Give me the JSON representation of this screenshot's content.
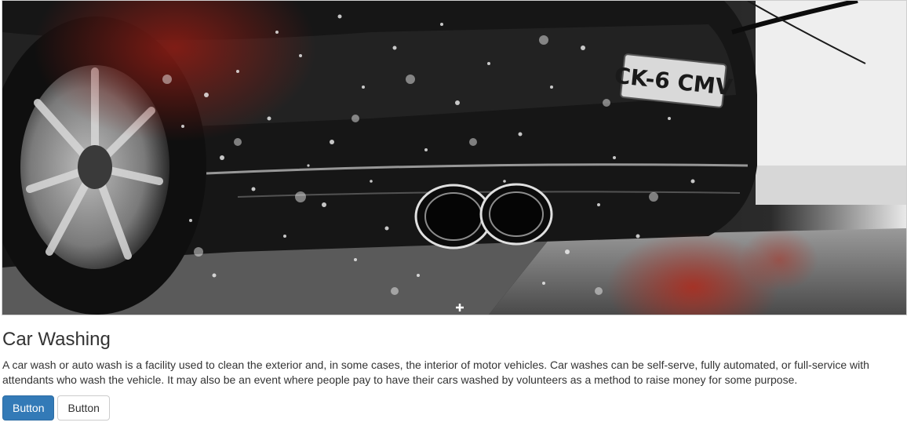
{
  "hero": {
    "plate_text": "CK-6 CMV"
  },
  "card": {
    "title": "Car Washing",
    "description": "A car wash or auto wash is a facility used to clean the exterior and, in some cases, the interior of motor vehicles. Car washes can be self-serve, fully automated, or full-service with attendants who wash the vehicle. It may also be an event where people pay to have their cars washed by volunteers as a method to raise money for some purpose.",
    "primary_button_label": "Button",
    "secondary_button_label": "Button"
  },
  "colors": {
    "primary": "#337ab7",
    "text": "#333333"
  }
}
